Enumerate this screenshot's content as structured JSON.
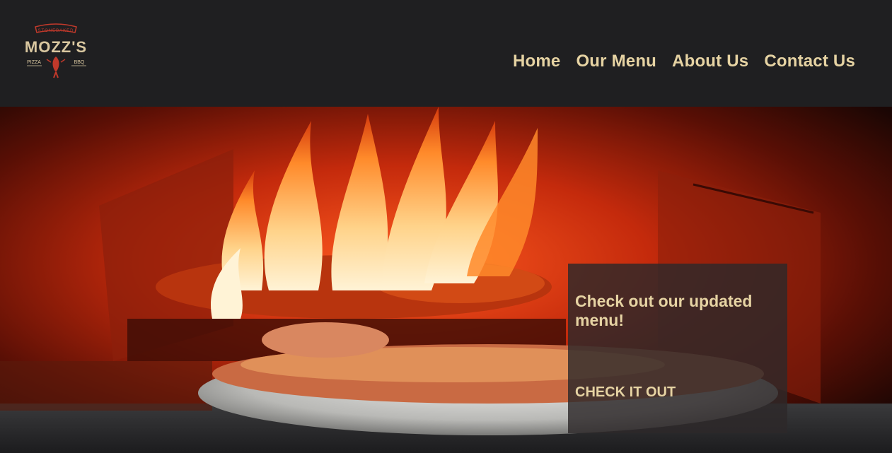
{
  "brand": {
    "top_text": "STONEBAKED",
    "name": "MOZZ'S",
    "left_text": "PIZZA",
    "right_text": "BBQ",
    "accent_color": "#c0392b",
    "text_color": "#d9c7a0"
  },
  "nav": {
    "items": [
      {
        "label": "Home"
      },
      {
        "label": "Our Menu"
      },
      {
        "label": "About Us"
      },
      {
        "label": "Contact Us"
      }
    ],
    "color": "#e6d3a3"
  },
  "hero": {
    "image_icon": "pizza-oven-fire-image"
  },
  "promo": {
    "title": "Check out our updated menu!",
    "cta_label": "CHECK IT OUT"
  }
}
